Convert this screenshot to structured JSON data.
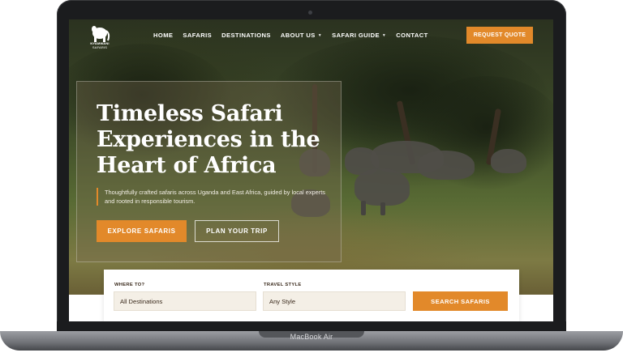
{
  "device": {
    "label": "MacBook Air"
  },
  "brand": {
    "logo_text": "NYAMWANI",
    "logo_subtext": "SAFARIS"
  },
  "nav": {
    "items": [
      {
        "label": "HOME",
        "dropdown": false
      },
      {
        "label": "SAFARIS",
        "dropdown": false
      },
      {
        "label": "DESTINATIONS",
        "dropdown": false
      },
      {
        "label": "ABOUT US",
        "dropdown": true
      },
      {
        "label": "SAFARI GUIDE",
        "dropdown": true
      },
      {
        "label": "CONTACT",
        "dropdown": false
      }
    ],
    "cta": "REQUEST QUOTE"
  },
  "hero": {
    "title": "Timeless Safari Experiences in the Heart of Africa",
    "description": "Thoughtfully crafted safaris across Uganda and East Africa, guided by local experts and rooted in responsible tourism.",
    "primary_button": "EXPLORE SAFARIS",
    "secondary_button": "PLAN YOUR TRIP"
  },
  "search": {
    "where_label": "WHERE TO?",
    "where_value": "All Destinations",
    "style_label": "TRAVEL STYLE",
    "style_value": "Any Style",
    "button": "SEARCH SAFARIS"
  },
  "colors": {
    "accent": "#e2892a",
    "field_bg": "#f4efe6"
  }
}
